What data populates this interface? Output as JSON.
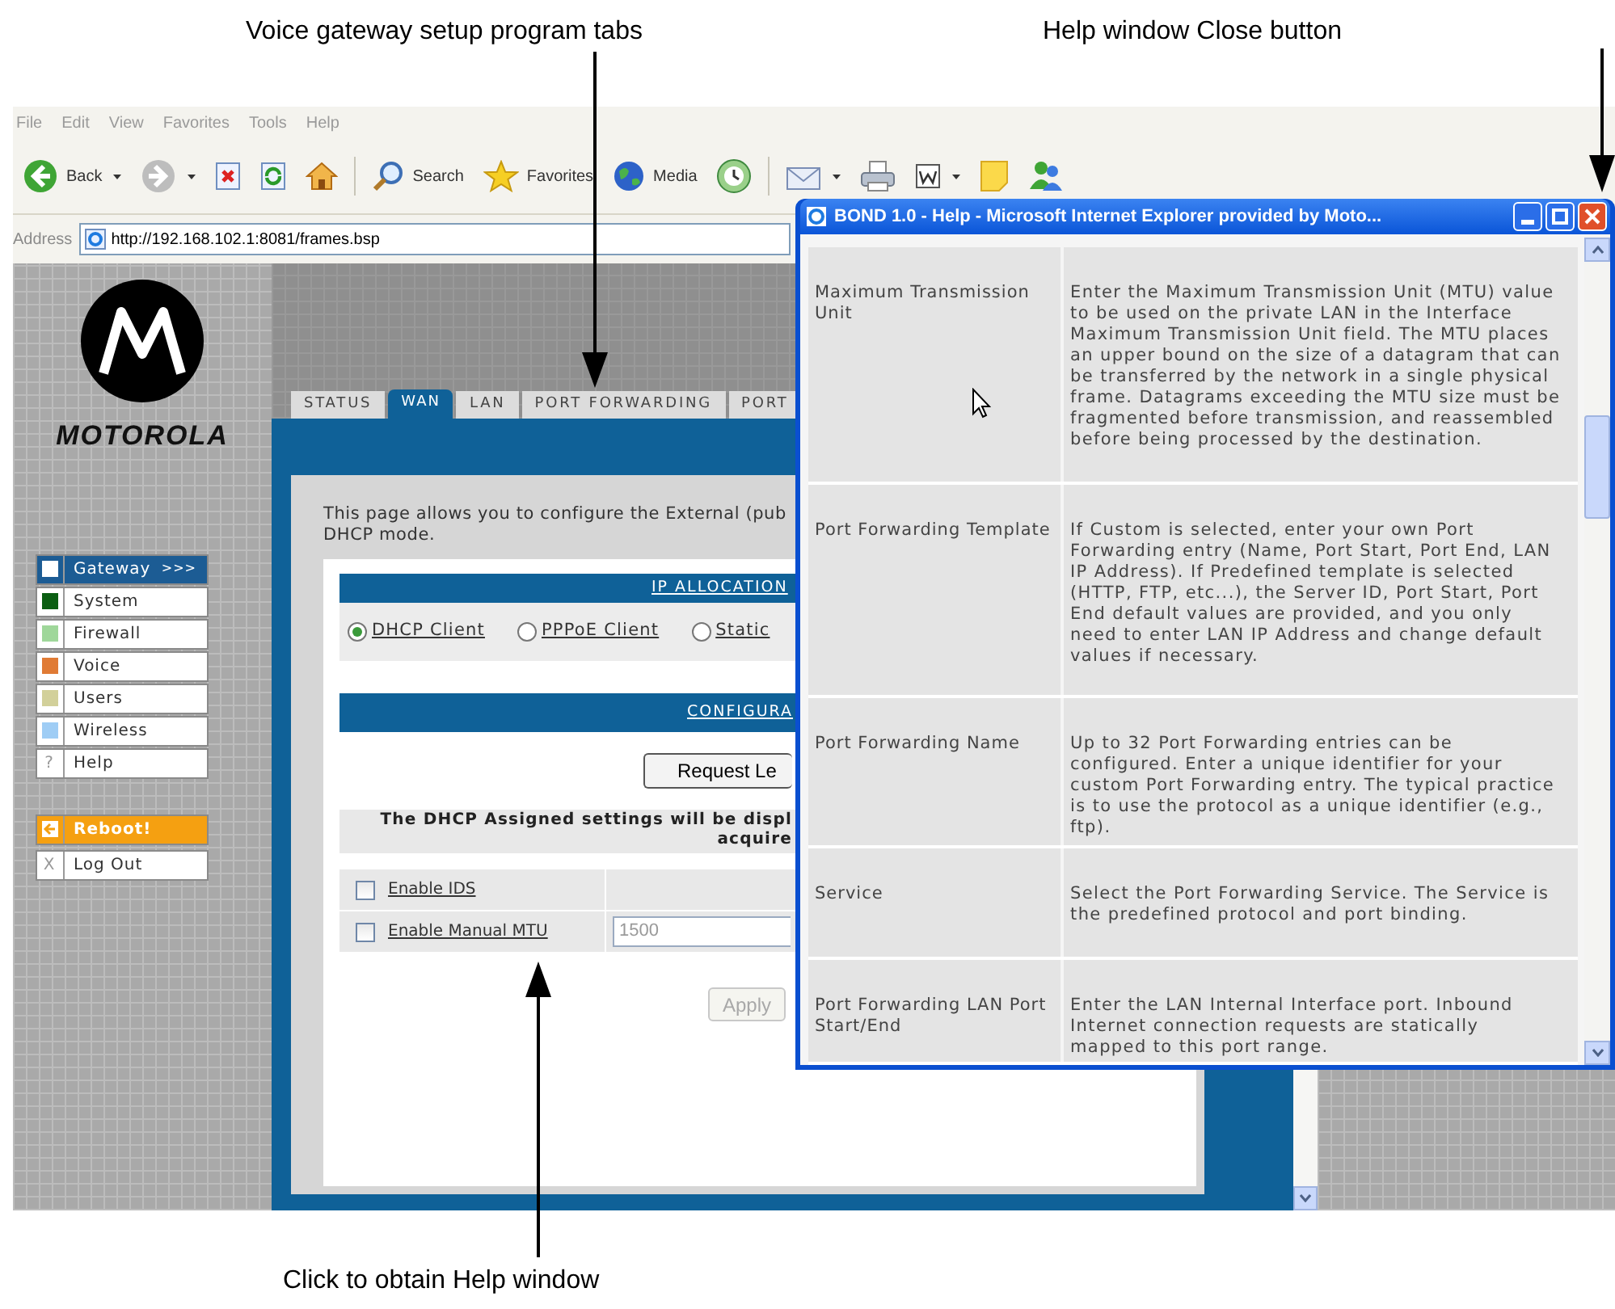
{
  "callouts": [
    {
      "text": "Voice gateway setup program tabs"
    },
    {
      "text": "Help window Close button"
    },
    {
      "text": "Click to obtain Help window"
    }
  ],
  "browser": {
    "menu": [
      "File",
      "Edit",
      "View",
      "Favorites",
      "Tools",
      "Help"
    ],
    "toolbar": [
      {
        "kind": "back",
        "label": "Back",
        "dropdown": true
      },
      {
        "kind": "forward",
        "dropdown": true
      },
      {
        "kind": "stop",
        "dropdown": false
      },
      {
        "kind": "refresh",
        "dropdown": false
      },
      {
        "kind": "home",
        "dropdown": false
      },
      {
        "kind": "search",
        "label": "Search",
        "dropdown": false
      },
      {
        "kind": "favorites",
        "label": "Favorites",
        "dropdown": false
      },
      {
        "kind": "media",
        "label": "Media",
        "dropdown": false
      },
      {
        "kind": "history",
        "dropdown": false
      },
      {
        "kind": "mail",
        "dropdown": true
      },
      {
        "kind": "print",
        "dropdown": false
      },
      {
        "kind": "edit",
        "dropdown": true
      },
      {
        "kind": "notes",
        "dropdown": false
      },
      {
        "kind": "messenger",
        "dropdown": false
      }
    ],
    "address_label": "Address",
    "url": "http://192.168.102.1:8081/frames.bsp"
  },
  "logo": {
    "text": "MOTOROLA"
  },
  "nav": [
    {
      "kind": "swatch",
      "label": "Gateway",
      "color": "#ffffff",
      "selected": true,
      "suffix": ">>>"
    },
    {
      "kind": "swatch",
      "label": "System",
      "color": "#0b5e12",
      "selected": false
    },
    {
      "kind": "swatch",
      "label": "Firewall",
      "color": "#9fd79a",
      "selected": false
    },
    {
      "kind": "swatch",
      "label": "Voice",
      "color": "#e07b35",
      "selected": false
    },
    {
      "kind": "swatch",
      "label": "Users",
      "color": "#d2d09a",
      "selected": false
    },
    {
      "kind": "swatch",
      "label": "Wireless",
      "color": "#9fcdf5",
      "selected": false
    },
    {
      "kind": "glyph",
      "label": "Help",
      "glyph": "?",
      "selected": false
    }
  ],
  "actions": [
    {
      "kind": "reboot",
      "label": "Reboot!"
    },
    {
      "kind": "glyph",
      "label": "Log Out",
      "glyph": "X"
    }
  ],
  "tabs": [
    {
      "label": "STATUS",
      "selected": false
    },
    {
      "label": "WAN",
      "selected": true
    },
    {
      "label": "LAN",
      "selected": false
    },
    {
      "label": "PORT FORWARDING",
      "selected": false
    },
    {
      "label": "PORT",
      "selected": false
    }
  ],
  "intro_lines": [
    "This page allows you to configure the External (pub",
    "DHCP mode."
  ],
  "ip_allocation": {
    "title": "IP ALLOCATION",
    "options": [
      {
        "label": "DHCP Client",
        "selected": true
      },
      {
        "label": "PPPoE Client",
        "selected": false
      },
      {
        "label": "Static",
        "selected": false
      }
    ]
  },
  "configuration": {
    "title": "CONFIGURA",
    "button": "Request Le",
    "notice_lines": [
      "The DHCP Assigned settings will be displ",
      "acquire"
    ]
  },
  "options": [
    {
      "label": "Enable IDS",
      "checked": false
    },
    {
      "label": "Enable Manual MTU",
      "checked": false,
      "value": "1500"
    }
  ],
  "apply": {
    "label": "Apply",
    "disabled": true
  },
  "help_window": {
    "title": "BOND 1.0 - Help - Microsoft Internet Explorer provided by Moto...",
    "rows": [
      {
        "term": "Maximum Transmission Unit",
        "description": "Enter the Maximum Transmission Unit (MTU) value to be used on the private LAN in the Interface Maximum Transmission Unit field. The MTU places an upper bound on the size of a datagram that can be transferred by the network in a single physical frame. Datagrams exceeding the MTU size must be fragmented before transmission, and reassembled before being processed by the destination."
      },
      {
        "term": "Port Forwarding Template",
        "description": "If Custom is selected, enter your own Port Forwarding entry (Name, Port Start, Port End, LAN IP Address). If Predefined template is selected (HTTP, FTP, etc...), the Server ID, Port Start, Port End default values are provided, and you only need to enter LAN IP Address and change default values if necessary."
      },
      {
        "term": "Port Forwarding Name",
        "description": "Up to 32 Port Forwarding entries can be configured. Enter a unique identifier for your custom Port Forwarding entry. The typical practice is to use the protocol as a unique identifier (e.g., ftp)."
      },
      {
        "term": "Service",
        "description": "Select the Port Forwarding Service. The Service is the predefined protocol and port binding."
      },
      {
        "term": "Port Forwarding LAN Port Start/End",
        "description": "Enter the LAN Internal Interface port. Inbound Internet connection requests are statically mapped to this port range."
      }
    ]
  }
}
